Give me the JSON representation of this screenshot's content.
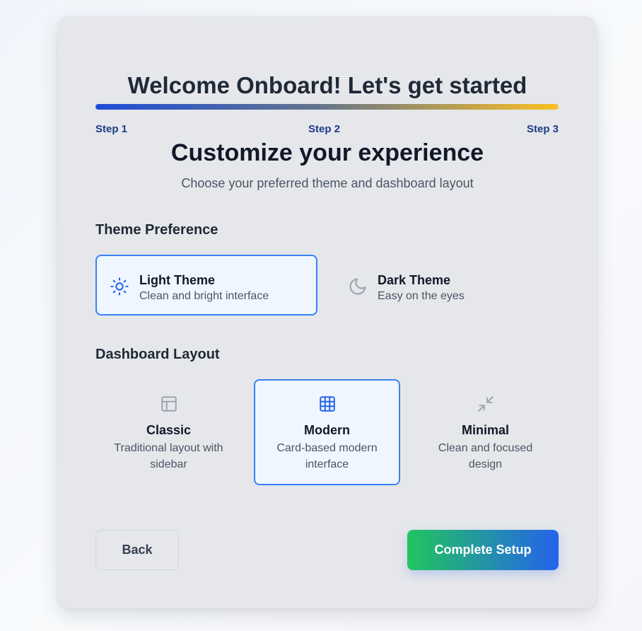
{
  "title": "Welcome Onboard! Let's get started",
  "progress": {
    "value": 1.0,
    "steps": [
      "Step 1",
      "Step 2",
      "Step 3"
    ]
  },
  "heading": "Customize your experience",
  "subheading": "Choose your preferred theme and dashboard layout",
  "theme": {
    "section_title": "Theme Preference",
    "options": [
      {
        "title": "Light Theme",
        "description": "Clean and bright interface",
        "icon": "sun-icon",
        "selected": true
      },
      {
        "title": "Dark Theme",
        "description": "Easy on the eyes",
        "icon": "moon-icon",
        "selected": false
      }
    ]
  },
  "layout": {
    "section_title": "Dashboard Layout",
    "options": [
      {
        "title": "Classic",
        "description": "Traditional layout with sidebar",
        "icon": "layout-sidebar-icon",
        "selected": false
      },
      {
        "title": "Modern",
        "description": "Card-based modern interface",
        "icon": "grid-icon",
        "selected": true
      },
      {
        "title": "Minimal",
        "description": "Clean and focused design",
        "icon": "minimize-icon",
        "selected": false
      }
    ]
  },
  "buttons": {
    "back": "Back",
    "complete": "Complete Setup"
  },
  "colors": {
    "accent": "#3b82f6",
    "step_text": "#1e3a8a",
    "selected_bg": "#eff6ff",
    "card_bg": "#e5e7eb",
    "complete_gradient_start": "#22c55e",
    "complete_gradient_end": "#2563eb"
  }
}
